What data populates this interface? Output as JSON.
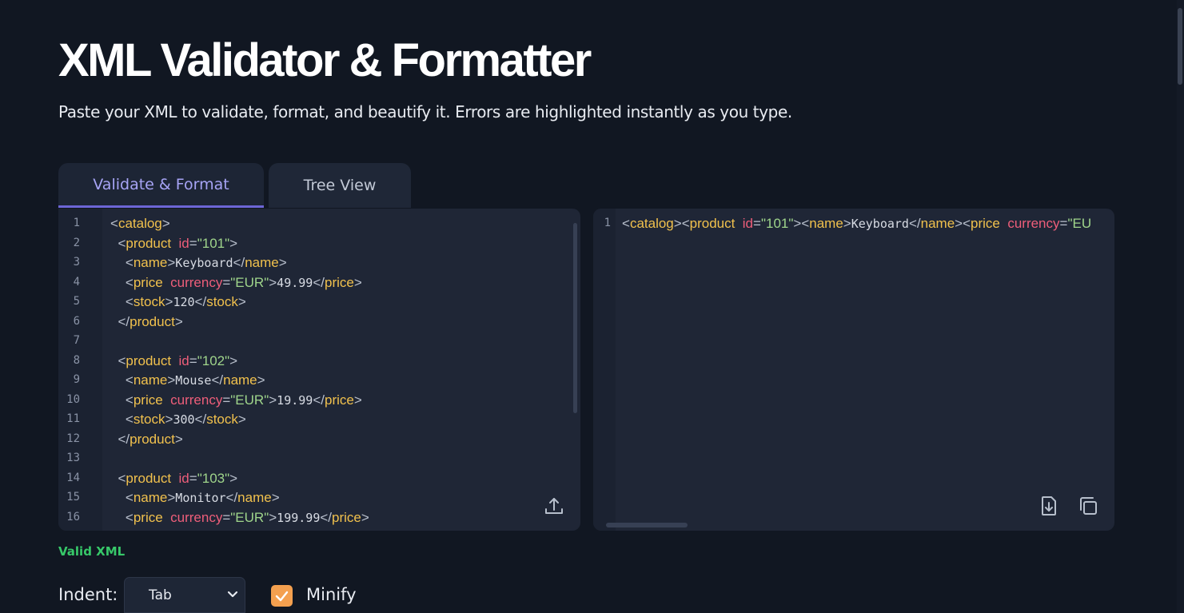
{
  "header": {
    "title": "XML Validator & Formatter",
    "subtitle": "Paste your XML to validate, format, and beautify it. Errors are highlighted instantly as you type."
  },
  "tabs": [
    {
      "label": "Validate & Format",
      "active": true
    },
    {
      "label": "Tree View",
      "active": false
    }
  ],
  "input_editor": {
    "line_numbers": [
      "1",
      "2",
      "3",
      "4",
      "5",
      "6",
      "7",
      "8",
      "9",
      "10",
      "11",
      "12",
      "13",
      "14",
      "15",
      "16"
    ],
    "lines": [
      [
        {
          "t": "pn",
          "v": "<"
        },
        {
          "t": "tg",
          "v": "catalog"
        },
        {
          "t": "pn",
          "v": ">"
        }
      ],
      [
        {
          "t": "pn",
          "v": "  <"
        },
        {
          "t": "tg",
          "v": "product"
        },
        {
          "t": "pn",
          "v": "  "
        },
        {
          "t": "at",
          "v": "id"
        },
        {
          "t": "pn",
          "v": "="
        },
        {
          "t": "st",
          "v": "\"101\""
        },
        {
          "t": "pn",
          "v": ">"
        }
      ],
      [
        {
          "t": "pn",
          "v": "    <"
        },
        {
          "t": "tg",
          "v": "name"
        },
        {
          "t": "pn",
          "v": ">"
        },
        {
          "t": "tx",
          "v": "Keyboard"
        },
        {
          "t": "pn",
          "v": "</"
        },
        {
          "t": "tg",
          "v": "name"
        },
        {
          "t": "pn",
          "v": ">"
        }
      ],
      [
        {
          "t": "pn",
          "v": "    <"
        },
        {
          "t": "tg",
          "v": "price"
        },
        {
          "t": "pn",
          "v": "  "
        },
        {
          "t": "at",
          "v": "currency"
        },
        {
          "t": "pn",
          "v": "="
        },
        {
          "t": "st",
          "v": "\"EUR\""
        },
        {
          "t": "pn",
          "v": ">"
        },
        {
          "t": "tx",
          "v": "49.99"
        },
        {
          "t": "pn",
          "v": "</"
        },
        {
          "t": "tg",
          "v": "price"
        },
        {
          "t": "pn",
          "v": ">"
        }
      ],
      [
        {
          "t": "pn",
          "v": "    <"
        },
        {
          "t": "tg",
          "v": "stock"
        },
        {
          "t": "pn",
          "v": ">"
        },
        {
          "t": "tx",
          "v": "120"
        },
        {
          "t": "pn",
          "v": "</"
        },
        {
          "t": "tg",
          "v": "stock"
        },
        {
          "t": "pn",
          "v": ">"
        }
      ],
      [
        {
          "t": "pn",
          "v": "  </"
        },
        {
          "t": "tg",
          "v": "product"
        },
        {
          "t": "pn",
          "v": ">"
        }
      ],
      [],
      [
        {
          "t": "pn",
          "v": "  <"
        },
        {
          "t": "tg",
          "v": "product"
        },
        {
          "t": "pn",
          "v": "  "
        },
        {
          "t": "at",
          "v": "id"
        },
        {
          "t": "pn",
          "v": "="
        },
        {
          "t": "st",
          "v": "\"102\""
        },
        {
          "t": "pn",
          "v": ">"
        }
      ],
      [
        {
          "t": "pn",
          "v": "    <"
        },
        {
          "t": "tg",
          "v": "name"
        },
        {
          "t": "pn",
          "v": ">"
        },
        {
          "t": "tx",
          "v": "Mouse"
        },
        {
          "t": "pn",
          "v": "</"
        },
        {
          "t": "tg",
          "v": "name"
        },
        {
          "t": "pn",
          "v": ">"
        }
      ],
      [
        {
          "t": "pn",
          "v": "    <"
        },
        {
          "t": "tg",
          "v": "price"
        },
        {
          "t": "pn",
          "v": "  "
        },
        {
          "t": "at",
          "v": "currency"
        },
        {
          "t": "pn",
          "v": "="
        },
        {
          "t": "st",
          "v": "\"EUR\""
        },
        {
          "t": "pn",
          "v": ">"
        },
        {
          "t": "tx",
          "v": "19.99"
        },
        {
          "t": "pn",
          "v": "</"
        },
        {
          "t": "tg",
          "v": "price"
        },
        {
          "t": "pn",
          "v": ">"
        }
      ],
      [
        {
          "t": "pn",
          "v": "    <"
        },
        {
          "t": "tg",
          "v": "stock"
        },
        {
          "t": "pn",
          "v": ">"
        },
        {
          "t": "tx",
          "v": "300"
        },
        {
          "t": "pn",
          "v": "</"
        },
        {
          "t": "tg",
          "v": "stock"
        },
        {
          "t": "pn",
          "v": ">"
        }
      ],
      [
        {
          "t": "pn",
          "v": "  </"
        },
        {
          "t": "tg",
          "v": "product"
        },
        {
          "t": "pn",
          "v": ">"
        }
      ],
      [],
      [
        {
          "t": "pn",
          "v": "  <"
        },
        {
          "t": "tg",
          "v": "product"
        },
        {
          "t": "pn",
          "v": "  "
        },
        {
          "t": "at",
          "v": "id"
        },
        {
          "t": "pn",
          "v": "="
        },
        {
          "t": "st",
          "v": "\"103\""
        },
        {
          "t": "pn",
          "v": ">"
        }
      ],
      [
        {
          "t": "pn",
          "v": "    <"
        },
        {
          "t": "tg",
          "v": "name"
        },
        {
          "t": "pn",
          "v": ">"
        },
        {
          "t": "tx",
          "v": "Monitor"
        },
        {
          "t": "pn",
          "v": "</"
        },
        {
          "t": "tg",
          "v": "name"
        },
        {
          "t": "pn",
          "v": ">"
        }
      ],
      [
        {
          "t": "pn",
          "v": "    <"
        },
        {
          "t": "tg",
          "v": "price"
        },
        {
          "t": "pn",
          "v": "  "
        },
        {
          "t": "at",
          "v": "currency"
        },
        {
          "t": "pn",
          "v": "="
        },
        {
          "t": "st",
          "v": "\"EUR\""
        },
        {
          "t": "pn",
          "v": ">"
        },
        {
          "t": "tx",
          "v": "199.99"
        },
        {
          "t": "pn",
          "v": "</"
        },
        {
          "t": "tg",
          "v": "price"
        },
        {
          "t": "pn",
          "v": ">"
        }
      ]
    ],
    "upload_icon": "upload-icon"
  },
  "output_editor": {
    "line_numbers": [
      "1"
    ],
    "lines": [
      [
        {
          "t": "pn",
          "v": "<"
        },
        {
          "t": "tg",
          "v": "catalog"
        },
        {
          "t": "pn",
          "v": "><"
        },
        {
          "t": "tg",
          "v": "product"
        },
        {
          "t": "pn",
          "v": "  "
        },
        {
          "t": "at",
          "v": "id"
        },
        {
          "t": "pn",
          "v": "="
        },
        {
          "t": "st",
          "v": "\"101\""
        },
        {
          "t": "pn",
          "v": "><"
        },
        {
          "t": "tg",
          "v": "name"
        },
        {
          "t": "pn",
          "v": ">"
        },
        {
          "t": "tx",
          "v": "Keyboard"
        },
        {
          "t": "pn",
          "v": "</"
        },
        {
          "t": "tg",
          "v": "name"
        },
        {
          "t": "pn",
          "v": "><"
        },
        {
          "t": "tg",
          "v": "price"
        },
        {
          "t": "pn",
          "v": "  "
        },
        {
          "t": "at",
          "v": "currency"
        },
        {
          "t": "pn",
          "v": "="
        },
        {
          "t": "st",
          "v": "\"EU"
        }
      ]
    ],
    "download_icon": "download-icon",
    "copy_icon": "copy-icon"
  },
  "status": {
    "text": "Valid XML"
  },
  "options": {
    "indent_label": "Indent:",
    "indent_value": "Tab",
    "minify_label": "Minify",
    "minify_checked": true
  },
  "colors": {
    "background": "#111722",
    "editor": "#1f2636",
    "tag": "#f1c14d",
    "attribute": "#ee5e7a",
    "string": "#9fd58b",
    "accent": "#6d66d6",
    "valid": "#37c869",
    "checkbox": "#f4a04f"
  }
}
